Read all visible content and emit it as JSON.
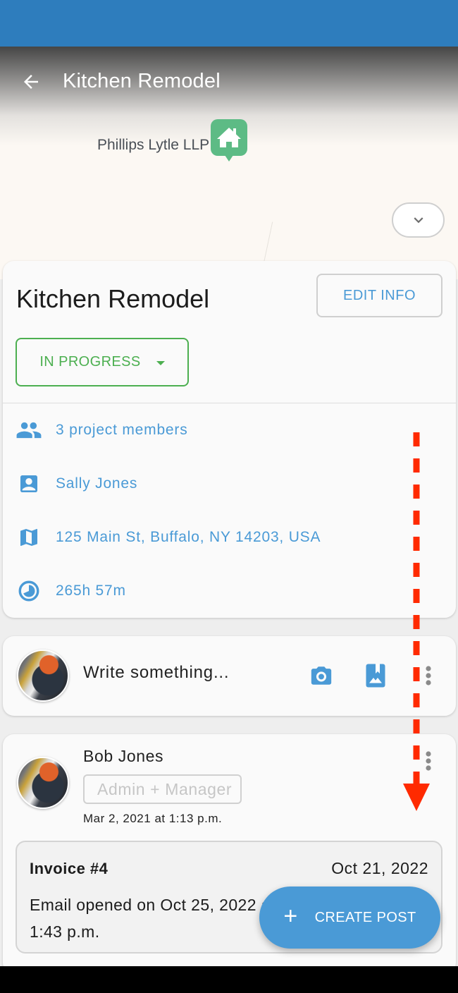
{
  "colors": {
    "status_bar": "#2e7dbd",
    "accent": "#4a9ad6",
    "status_green": "#4caf50",
    "map_pin": "#5dbb85",
    "annotation_red": "#ff2a00"
  },
  "header": {
    "title": "Kitchen Remodel",
    "back_icon": "arrow-left-icon"
  },
  "map": {
    "place_label": "Phillips Lytle LLP",
    "pin_icon": "house-pin-icon",
    "collapse_icon": "chevron-down-icon"
  },
  "project": {
    "title": "Kitchen Remodel",
    "edit_label": "EDIT INFO",
    "status": "IN PROGRESS",
    "details": [
      {
        "icon": "people-icon",
        "text": "3 project members"
      },
      {
        "icon": "contact-icon",
        "text": "Sally Jones"
      },
      {
        "icon": "map-icon",
        "text": "125 Main St, Buffalo, NY 14203, USA"
      },
      {
        "icon": "clock-icon",
        "text": "265h 57m"
      }
    ]
  },
  "composer": {
    "placeholder": "Write something...",
    "camera_icon": "camera-icon",
    "gallery_icon": "photo-library-icon",
    "more_icon": "more-vertical-icon"
  },
  "post": {
    "author": "Bob Jones",
    "role": "Admin + Manager",
    "timestamp": "Mar 2, 2021 at 1:13 p.m.",
    "invoice": {
      "title": "Invoice #4",
      "date": "Oct 21, 2022",
      "body": "Email opened on Oct 25, 2022 at 1:43 p.m."
    }
  },
  "fab": {
    "icon": "plus-icon",
    "label": "CREATE POST"
  },
  "annotation": {
    "type": "scroll-down-arrow",
    "direction": "down"
  }
}
